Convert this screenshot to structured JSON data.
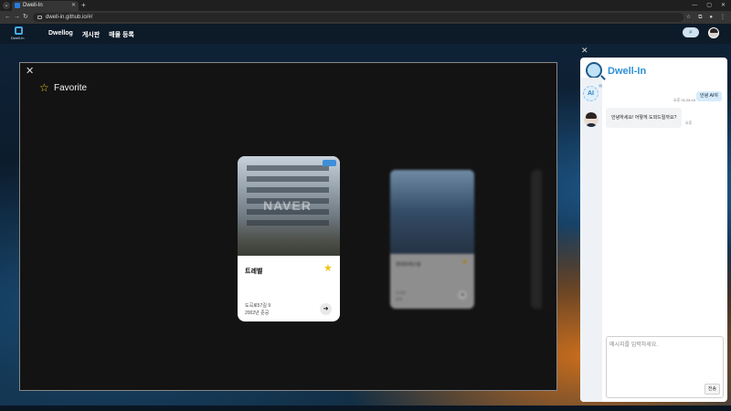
{
  "browser": {
    "tab_title": "Dwell-In",
    "new_tab": "+",
    "url": "dwell-in.github.io/#/",
    "window_controls": [
      "—",
      "▢",
      "✕"
    ]
  },
  "header": {
    "logo_text": "Dwell-In",
    "nav": [
      "Dwellog",
      "게시판",
      "매물 등록"
    ]
  },
  "favorite": {
    "title": "Favorite",
    "cards": [
      {
        "name": "트레벨",
        "badge": "",
        "address": "도곡로57길 9",
        "year": "2002년 준공",
        "favorited": true
      },
      {
        "name": "현대트레스빌",
        "badge": "",
        "address": "도곡로",
        "year": "준공",
        "favorited": true
      }
    ]
  },
  "chat": {
    "title": "Dwell-In",
    "ai_badge": "AI",
    "user_message": "안녕 AI야",
    "user_time": "오후 01:28:16",
    "ai_message": "안녕하세요! 어떻게 도와드릴까요?",
    "ai_time": "오후",
    "input_placeholder": "메시지를 입력하세요.",
    "send_label": "전송"
  },
  "colors": {
    "accent": "#2e8fd6",
    "star": "#f0c419",
    "modal_bg": "#131313"
  }
}
